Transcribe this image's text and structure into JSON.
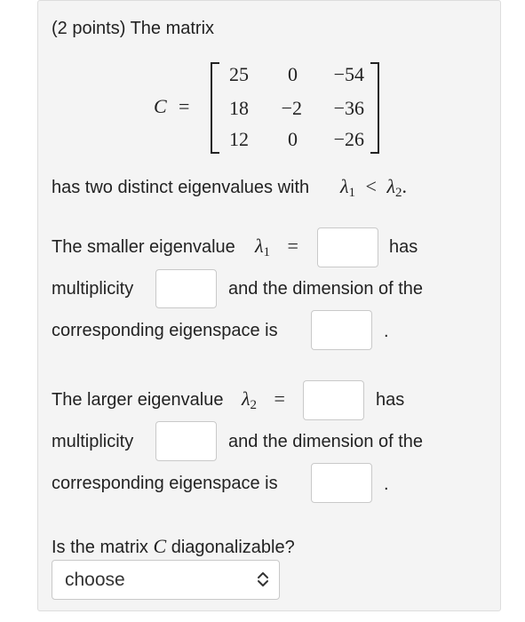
{
  "question": {
    "header": "(2 points) The matrix",
    "matrix": {
      "var": "C",
      "eq": "=",
      "rows": [
        [
          "25",
          "0",
          "−54"
        ],
        [
          "18",
          "−2",
          "−36"
        ],
        [
          "12",
          "0",
          "−26"
        ]
      ]
    },
    "distinct_text": "has two distinct eigenvalues with",
    "ineq": {
      "l1": "λ",
      "s1": "1",
      "op": "<",
      "l2": "λ",
      "s2": "2",
      "end": "."
    },
    "smaller": {
      "prefix": "The smaller eigenvalue",
      "lambda": "λ",
      "sub": "1",
      "eq": "=",
      "has": "has",
      "multiplicity": "multiplicity",
      "and_dim": "and the dimension of the",
      "corresponding": "corresponding eigenspace is",
      "period": "."
    },
    "larger": {
      "prefix": "The larger eigenvalue",
      "lambda": "λ",
      "sub": "2",
      "eq": "=",
      "has": "has",
      "multiplicity": "multiplicity",
      "and_dim": "and the dimension of the",
      "corresponding": "corresponding eigenspace is",
      "period": "."
    },
    "diag_prefix": "Is the matrix",
    "diag_var": "C",
    "diag_suffix": "diagonalizable?",
    "select": {
      "value": "choose"
    }
  }
}
